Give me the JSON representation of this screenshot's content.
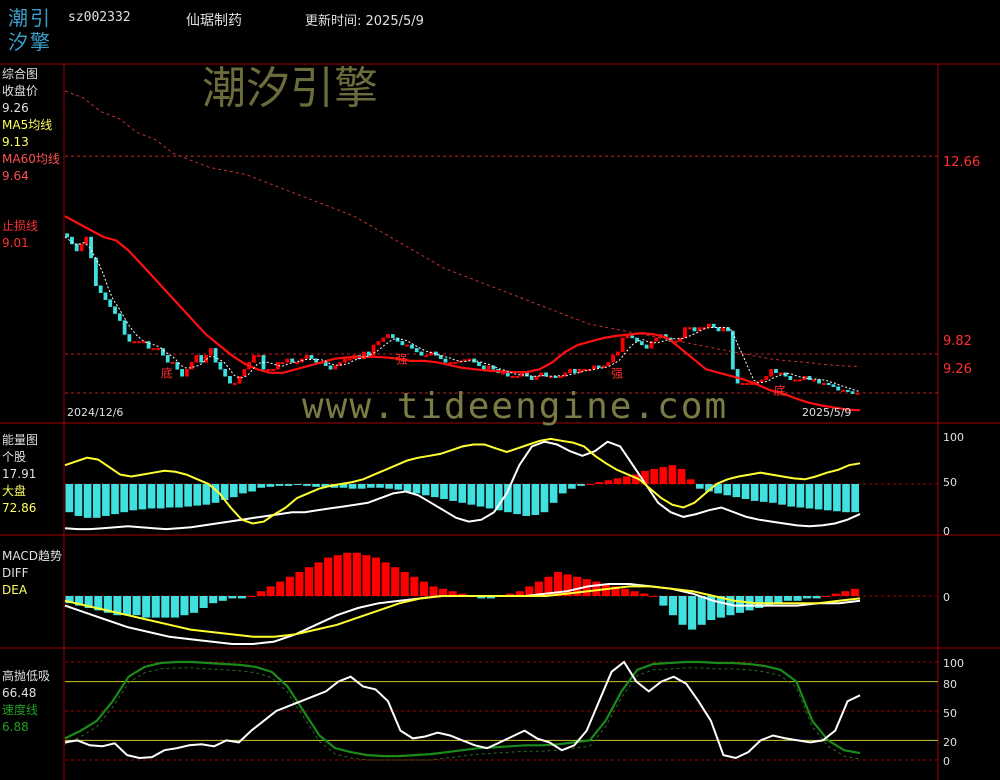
{
  "header": {
    "logo_line1": "潮引",
    "logo_line2": "汐擎",
    "code": "sz002332",
    "name": "仙琚制药",
    "update_label": "更新时间: 2025/5/9"
  },
  "watermarks": {
    "brand": "潮汐引擎",
    "url": "www.tideengine.com"
  },
  "colors": {
    "background": "#000000",
    "frame": "#a00000",
    "up_bar": "#ff0000",
    "down_bar": "#40e0e0",
    "ma5": "#ffffff",
    "ma60": "#e03030",
    "stop_loss": "#ff1010",
    "diff": "#ffffff",
    "dea": "#ffff30",
    "speed": "#1a8a1a",
    "label_white": "#e0e0e0",
    "label_yellow": "#ffff60",
    "label_red": "#ff5050",
    "label_green": "#20a020"
  },
  "panels": {
    "main": {
      "title": "综合图",
      "close_label": "收盘价",
      "close_value": "9.26",
      "ma5_label": "MA5均线",
      "ma5_value": "9.13",
      "ma60_label": "MA60均线",
      "ma60_value": "9.64",
      "stop_label": "止损线",
      "stop_value": "9.01",
      "price_levels": [
        "12.66",
        "9.82",
        "9.26"
      ],
      "date_start": "2024/12/6",
      "date_end": "2025/5/9",
      "annotations": [
        {
          "text": "底",
          "index": 20
        },
        {
          "text": "强",
          "index": 69
        },
        {
          "text": "强",
          "index": 114
        },
        {
          "text": "底",
          "index": 148
        }
      ]
    },
    "energy": {
      "title": "能量图",
      "stock_label": "个股",
      "stock_value": "17.91",
      "market_label": "大盘",
      "market_value": "72.86",
      "scale": [
        "100",
        "50",
        "0"
      ]
    },
    "macd": {
      "title": "MACD趋势",
      "diff_label": "DIFF",
      "dea_label": "DEA",
      "scale": [
        "0"
      ]
    },
    "kd": {
      "title": "高抛低吸",
      "value": "66.48",
      "speed_label": "速度线",
      "speed_value": "6.88",
      "scale": [
        "100",
        "80",
        "50",
        "20",
        "0"
      ]
    }
  },
  "chart_data": [
    {
      "type": "candlestick",
      "panel": "综合图",
      "x_start": "2024/12/6",
      "x_end": "2025/5/9",
      "ylim": [
        8.9,
        13.9
      ],
      "reference_lines": [
        12.66,
        9.82,
        9.26
      ],
      "close": [
        11.5,
        11.4,
        11.3,
        11.4,
        11.5,
        11.2,
        10.8,
        10.7,
        10.6,
        10.5,
        10.4,
        10.3,
        10.1,
        10.0,
        10.0,
        10.0,
        10.0,
        9.9,
        9.9,
        9.9,
        9.8,
        9.7,
        9.7,
        9.6,
        9.5,
        9.6,
        9.7,
        9.8,
        9.7,
        9.8,
        9.9,
        9.7,
        9.6,
        9.5,
        9.4,
        9.4,
        9.5,
        9.6,
        9.7,
        9.8,
        9.8,
        9.6,
        9.6,
        9.6,
        9.7,
        9.7,
        9.75,
        9.7,
        9.7,
        9.75,
        9.8,
        9.75,
        9.7,
        9.7,
        9.65,
        9.6,
        9.65,
        9.7,
        9.75,
        9.75,
        9.8,
        9.75,
        9.85,
        9.8,
        9.95,
        10.0,
        10.05,
        10.1,
        10.05,
        10.0,
        9.95,
        9.95,
        9.9,
        9.85,
        9.8,
        9.8,
        9.85,
        9.8,
        9.75,
        9.7,
        9.7,
        9.7,
        9.72,
        9.74,
        9.75,
        9.7,
        9.65,
        9.6,
        9.65,
        9.6,
        9.55,
        9.55,
        9.5,
        9.5,
        9.5,
        9.55,
        9.5,
        9.45,
        9.5,
        9.55,
        9.5,
        9.5,
        9.48,
        9.5,
        9.55,
        9.6,
        9.55,
        9.6,
        9.6,
        9.6,
        9.65,
        9.62,
        9.65,
        9.7,
        9.8,
        9.85,
        10.05,
        10.08,
        10.05,
        10.0,
        9.95,
        9.9,
        10.0,
        10.05,
        10.1,
        10.05,
        10.0,
        10.0,
        10.05,
        10.2,
        10.2,
        10.15,
        10.2,
        10.2,
        10.25,
        10.2,
        10.15,
        10.2,
        10.15,
        9.6,
        9.4,
        9.4,
        9.4,
        9.4,
        9.42,
        9.45,
        9.5,
        9.6,
        9.55,
        9.55,
        9.5,
        9.45,
        9.45,
        9.45,
        9.5,
        9.45,
        9.45,
        9.4,
        9.4,
        9.38,
        9.35,
        9.3,
        9.3,
        9.28,
        9.25,
        9.26
      ]
    },
    {
      "type": "line",
      "panel": "综合图",
      "series": [
        {
          "name": "MA60均线",
          "values": [
            13.6,
            13.5,
            13.3,
            13.2,
            13.0,
            12.9,
            12.7,
            12.6,
            12.5,
            12.45,
            12.4,
            12.3,
            12.2,
            12.1,
            12.0,
            11.9,
            11.8,
            11.65,
            11.5,
            11.35,
            11.2,
            11.05,
            10.95,
            10.85,
            10.75,
            10.65,
            10.55,
            10.45,
            10.35,
            10.25,
            10.2,
            10.15,
            10.1,
            10.05,
            10.0,
            9.95,
            9.9,
            9.85,
            9.8,
            9.75,
            9.72,
            9.7,
            9.67,
            9.65,
            9.64
          ]
        },
        {
          "name": "止损线",
          "values": [
            11.8,
            11.7,
            11.6,
            11.5,
            11.45,
            11.3,
            11.1,
            10.9,
            10.7,
            10.5,
            10.3,
            10.1,
            9.95,
            9.8,
            9.68,
            9.6,
            9.55,
            9.55,
            9.6,
            9.65,
            9.7,
            9.75,
            9.77,
            9.78,
            9.78,
            9.77,
            9.75,
            9.72,
            9.72,
            9.7,
            9.66,
            9.62,
            9.6,
            9.58,
            9.57,
            9.56,
            9.56,
            9.6,
            9.7,
            9.85,
            9.95,
            10.0,
            10.05,
            10.08,
            10.1,
            10.12,
            10.1,
            10.05,
            9.9,
            9.75,
            9.6,
            9.55,
            9.5,
            9.45,
            9.38,
            9.3,
            9.25,
            9.18,
            9.12,
            9.08,
            9.05,
            9.02,
            9.01
          ]
        }
      ]
    },
    {
      "type": "bar",
      "panel": "能量图",
      "values": [
        -30,
        -34,
        -36,
        -36,
        -34,
        -32,
        -30,
        -28,
        -27,
        -26,
        -26,
        -25,
        -25,
        -24,
        -23,
        -22,
        -20,
        -17,
        -14,
        -10,
        -8,
        -4,
        -3,
        -2,
        -2,
        -1,
        -2,
        -3,
        -3,
        -4,
        -4,
        -5,
        -5,
        -4,
        -4,
        -5,
        -6,
        -8,
        -10,
        -12,
        -14,
        -16,
        -18,
        -20,
        -22,
        -24,
        -26,
        -28,
        -30,
        -32,
        -34,
        -33,
        -30,
        -20,
        -10,
        -5,
        -2,
        0,
        2,
        4,
        6,
        8,
        10,
        14,
        16,
        18,
        20,
        16,
        5,
        -5,
        -8,
        -10,
        -12,
        -14,
        -16,
        -18,
        -19,
        -20,
        -22,
        -24,
        -25,
        -26,
        -27,
        -28,
        -29,
        -30,
        -30
      ]
    },
    {
      "type": "line",
      "panel": "能量图",
      "ylim": [
        0,
        100
      ],
      "series": [
        {
          "name": "个股",
          "values": [
            3,
            2,
            2,
            3,
            4,
            5,
            4,
            3,
            2,
            3,
            4,
            6,
            8,
            10,
            12,
            14,
            16,
            18,
            20,
            20,
            22,
            24,
            26,
            28,
            30,
            35,
            40,
            42,
            38,
            30,
            22,
            14,
            10,
            12,
            20,
            40,
            70,
            90,
            95,
            92,
            85,
            80,
            85,
            95,
            90,
            70,
            50,
            30,
            20,
            15,
            18,
            22,
            25,
            20,
            15,
            12,
            10,
            8,
            6,
            5,
            6,
            8,
            12,
            18
          ]
        },
        {
          "name": "大盘",
          "values": [
            70,
            74,
            78,
            76,
            68,
            60,
            58,
            60,
            62,
            64,
            63,
            60,
            55,
            50,
            40,
            25,
            12,
            8,
            10,
            18,
            25,
            35,
            40,
            45,
            48,
            50,
            52,
            55,
            60,
            65,
            70,
            75,
            78,
            80,
            82,
            86,
            90,
            92,
            92,
            88,
            84,
            88,
            92,
            96,
            98,
            96,
            94,
            90,
            80,
            72,
            65,
            60,
            55,
            45,
            35,
            28,
            25,
            30,
            40,
            50,
            55,
            58,
            60,
            62,
            60,
            58,
            56,
            55,
            58,
            62,
            65,
            70,
            72
          ]
        }
      ]
    },
    {
      "type": "bar",
      "panel": "MACD趋势",
      "values": [
        -3,
        -4,
        -5,
        -6,
        -7,
        -8,
        -8,
        -8,
        -9,
        -9,
        -9,
        -9,
        -8,
        -7,
        -5,
        -3,
        -2,
        -1,
        -1,
        0,
        2,
        4,
        6,
        8,
        10,
        12,
        14,
        16,
        17,
        18,
        18,
        17,
        16,
        14,
        12,
        10,
        8,
        6,
        4,
        3,
        2,
        1,
        0,
        -1,
        -1,
        0,
        1,
        2,
        4,
        6,
        8,
        10,
        9,
        8,
        7,
        6,
        5,
        4,
        3,
        2,
        1,
        0,
        -4,
        -8,
        -12,
        -14,
        -12,
        -10,
        -9,
        -8,
        -7,
        -6,
        -5,
        -4,
        -3,
        -2,
        -2,
        -1,
        -1,
        0,
        1,
        2,
        3
      ]
    },
    {
      "type": "line",
      "panel": "MACD趋势",
      "series": [
        {
          "name": "DIFF",
          "values": [
            -4,
            -7,
            -10,
            -13,
            -15,
            -17,
            -18,
            -19,
            -20,
            -20,
            -19,
            -16,
            -12,
            -8,
            -5,
            -3,
            -2,
            -1,
            0,
            0,
            0,
            0,
            0,
            1,
            2,
            4,
            5,
            5,
            4,
            3,
            1,
            -2,
            -4,
            -4,
            -4,
            -4,
            -3,
            -3,
            -2
          ]
        },
        {
          "name": "DEA",
          "values": [
            -2,
            -4,
            -6,
            -8,
            -10,
            -12,
            -14,
            -15,
            -16,
            -17,
            -17,
            -16,
            -14,
            -12,
            -9,
            -6,
            -3,
            -1,
            0,
            0,
            0,
            0,
            0,
            0,
            1,
            2,
            3,
            4,
            4,
            3,
            2,
            0,
            -2,
            -3,
            -3,
            -3,
            -3,
            -2,
            -1
          ]
        }
      ]
    },
    {
      "type": "line",
      "panel": "高抛低吸",
      "ylim": [
        0,
        100
      ],
      "reference_lines": [
        80,
        50,
        20
      ],
      "series": [
        {
          "name": "高抛低吸",
          "values": [
            18,
            20,
            15,
            14,
            17,
            5,
            2,
            3,
            10,
            12,
            15,
            16,
            14,
            20,
            18,
            30,
            40,
            50,
            55,
            60,
            65,
            70,
            80,
            85,
            75,
            72,
            60,
            30,
            22,
            24,
            28,
            25,
            20,
            15,
            12,
            18,
            24,
            30,
            22,
            18,
            10,
            15,
            30,
            60,
            90,
            100,
            80,
            70,
            80,
            85,
            78,
            60,
            40,
            5,
            2,
            8,
            20,
            25,
            22,
            20,
            18,
            20,
            30,
            60,
            66
          ]
        },
        {
          "name": "速度线",
          "values": [
            22,
            30,
            40,
            60,
            85,
            95,
            99,
            100,
            100,
            99,
            98,
            97,
            95,
            90,
            75,
            50,
            25,
            12,
            8,
            5,
            4,
            4,
            5,
            6,
            8,
            10,
            12,
            13,
            14,
            15,
            15,
            16,
            18,
            20,
            40,
            70,
            92,
            98,
            99,
            100,
            100,
            99,
            99,
            98,
            96,
            92,
            80,
            40,
            20,
            10,
            7
          ]
        }
      ]
    }
  ]
}
